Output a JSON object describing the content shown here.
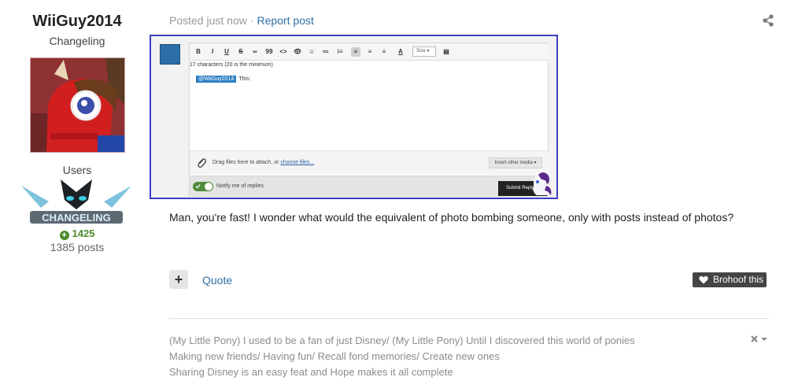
{
  "author": {
    "name": "WiiGuy2014",
    "rank": "Changeling",
    "group": "Users",
    "group_badge_text": "CHANGELING",
    "reputation": "1425",
    "post_count": "1385 posts"
  },
  "post": {
    "posted": "Posted just now",
    "separator": "·",
    "report_label": "Report post",
    "body": "Man, you're fast! I wonder what would the equivalent of photo bombing someone, only with posts instead of photos?"
  },
  "screenshot": {
    "toolbar": [
      "B",
      "I",
      "U",
      "S",
      "∞",
      "99",
      "<>",
      "👁",
      "☺",
      "≔",
      "⁝≡",
      "≡",
      "≡",
      "≡",
      "A"
    ],
    "size_label": "Size",
    "char_count": "17 characters (20 is the minimum)",
    "mention": "@WiiGuy2014",
    "mention_text": "This:",
    "attach_text": "Drag files here to attach, or",
    "attach_link": "choose files...",
    "media_button": "Insert other media ▾",
    "notify_label": "Notify me of replies",
    "submit_label": "Submit Reply"
  },
  "actions": {
    "plus_label": "+",
    "quote_label": "Quote",
    "brohoof_label": "Brohoof this"
  },
  "signature": {
    "lines": [
      "(My Little Pony) I used to be a fan of just Disney/ (My Little Pony) Until I discovered this world of ponies",
      "Making new friends/ Having fun/ Recall fond memories/ Create new ones",
      "Sharing Disney is an easy feat and Hope makes it all complete"
    ]
  },
  "colors": {
    "link": "#2f6ea5",
    "reputation": "#4b8a2c",
    "highlight_border": "#3b3fc4"
  }
}
